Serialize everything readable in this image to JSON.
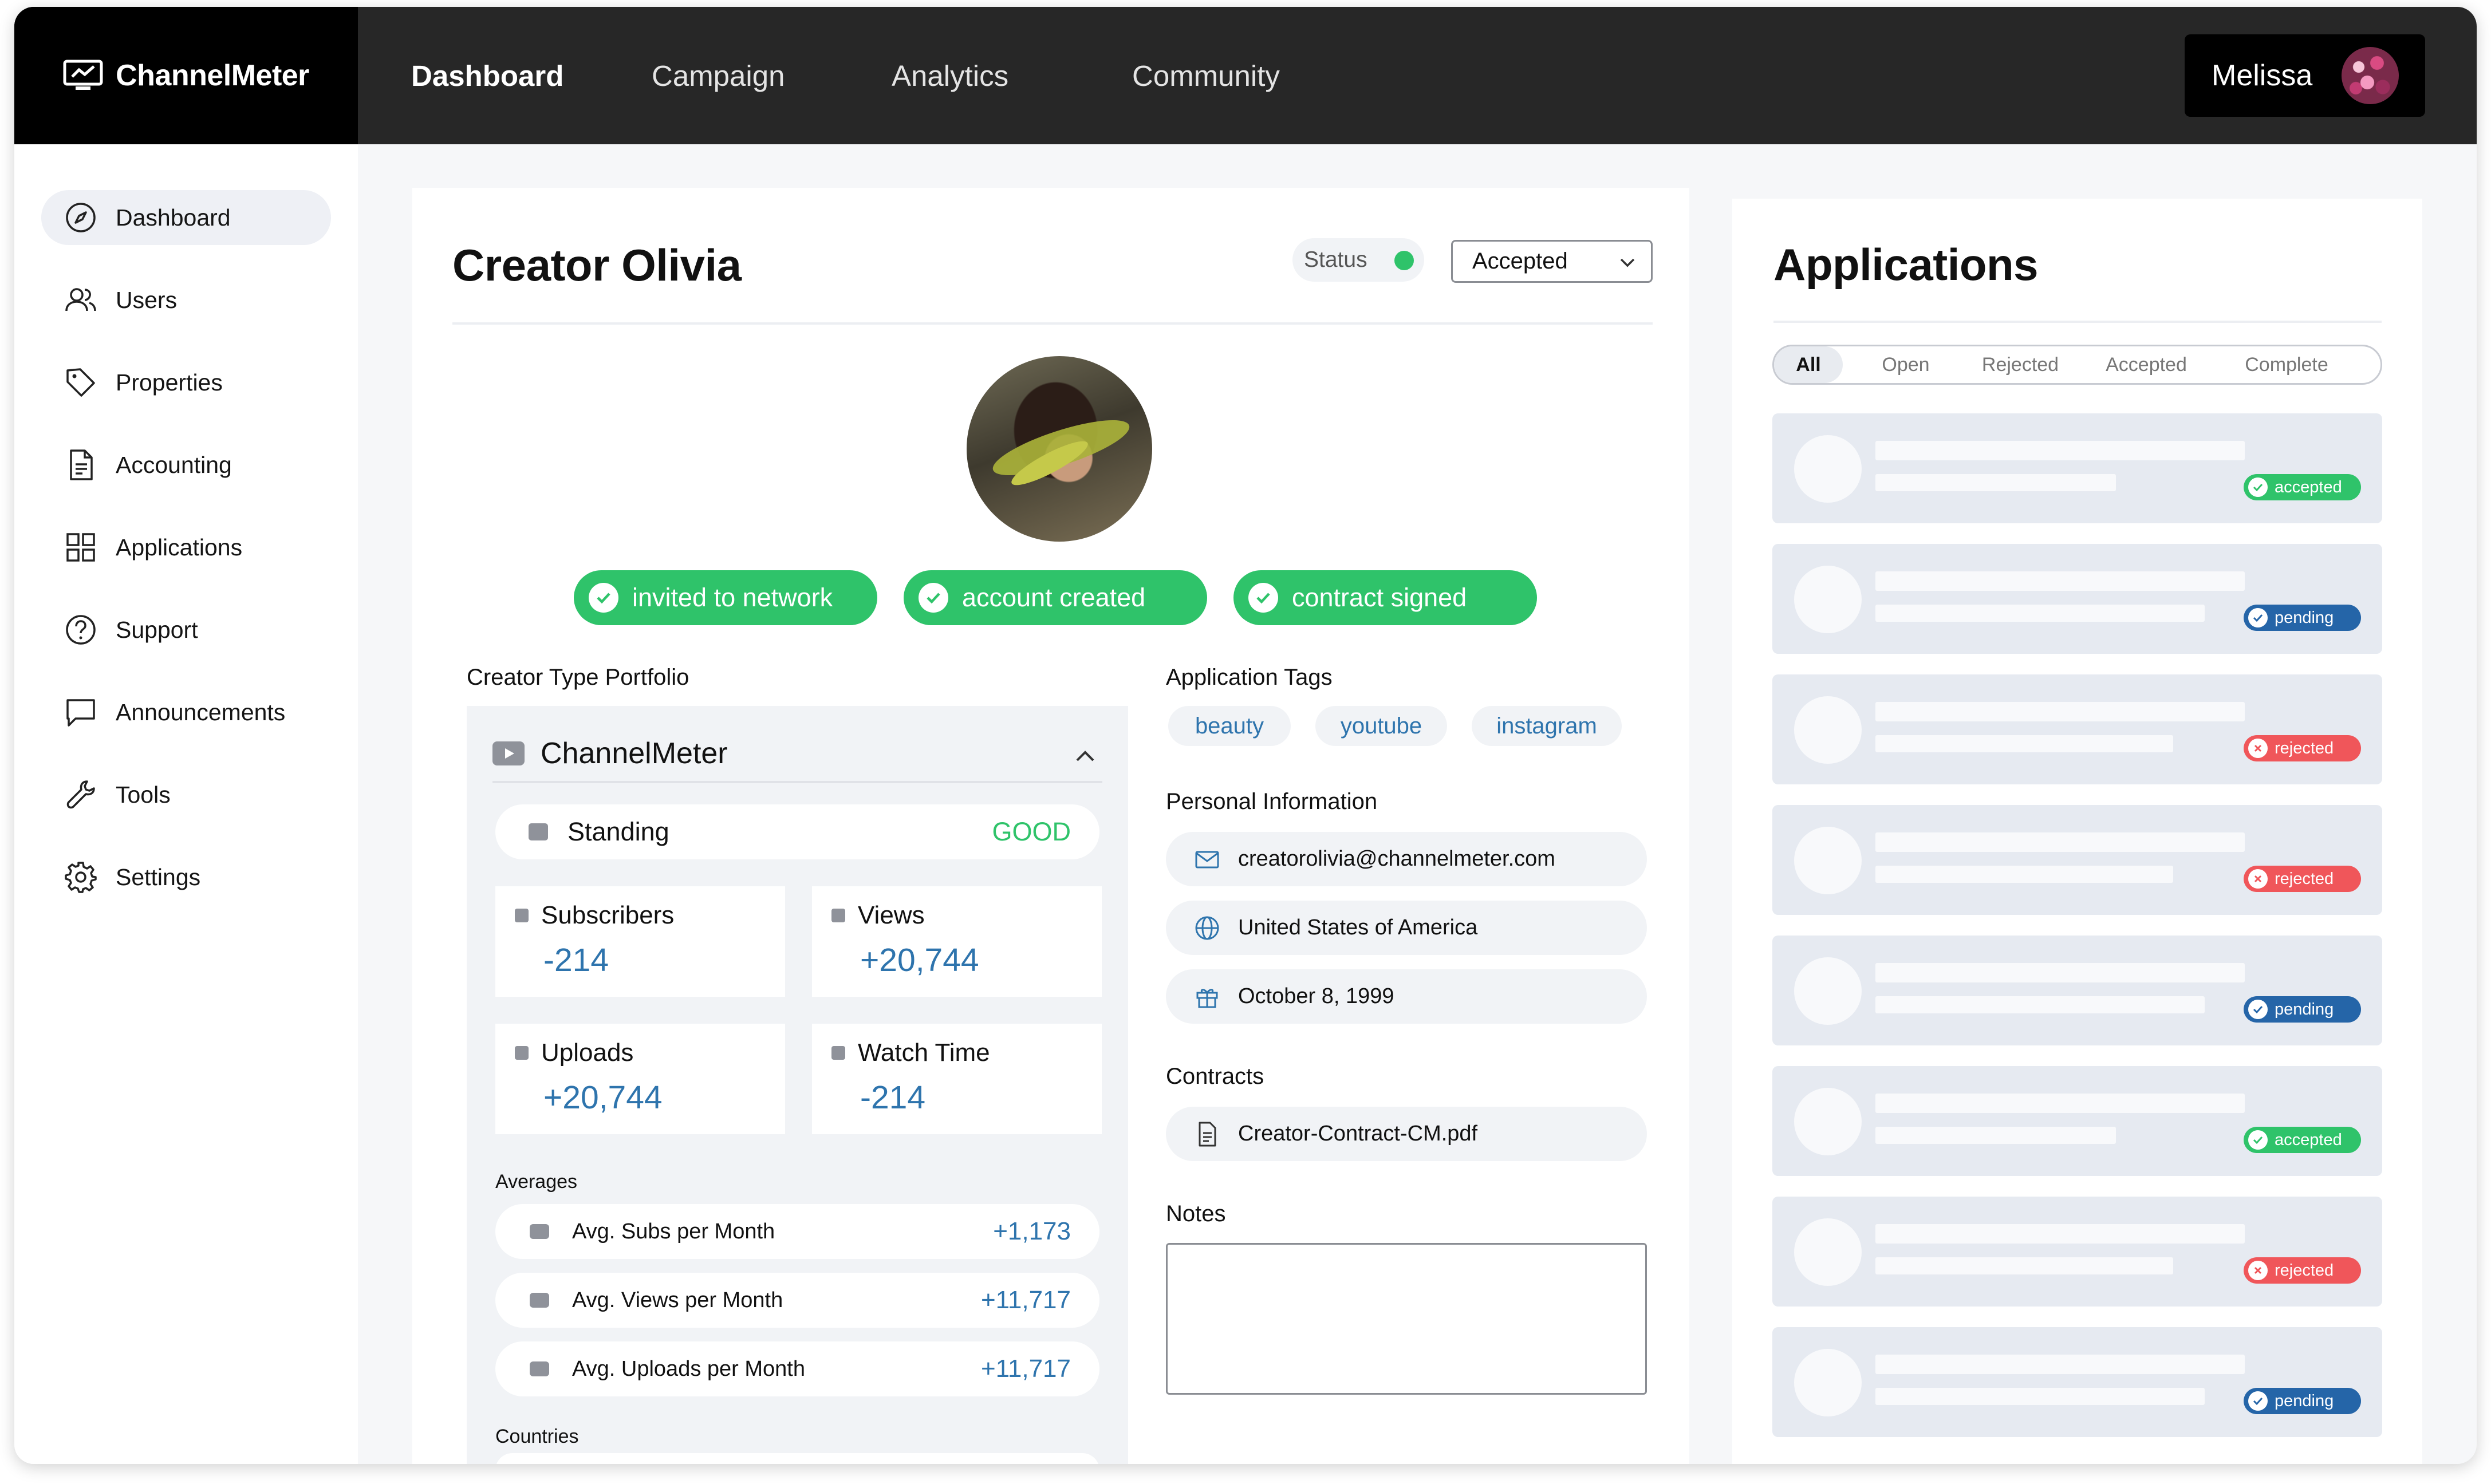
{
  "brand": "ChannelMeter",
  "topnav": [
    "Dashboard",
    "Campaign",
    "Analytics",
    "Community"
  ],
  "user": {
    "name": "Melissa"
  },
  "sidebar": {
    "items": [
      {
        "label": "Dashboard",
        "icon": "compass-icon"
      },
      {
        "label": "Users",
        "icon": "users-icon"
      },
      {
        "label": "Properties",
        "icon": "tag-icon"
      },
      {
        "label": "Accounting",
        "icon": "document-icon"
      },
      {
        "label": "Applications",
        "icon": "grid-icon"
      },
      {
        "label": "Support",
        "icon": "help-icon"
      },
      {
        "label": "Announcements",
        "icon": "chat-icon"
      },
      {
        "label": "Tools",
        "icon": "wrench-icon"
      },
      {
        "label": "Settings",
        "icon": "gear-icon"
      }
    ]
  },
  "creator": {
    "title": "Creator Olivia",
    "status_label": "Status",
    "status_value": "Accepted",
    "badges": [
      "invited to network",
      "account created",
      "contract signed"
    ]
  },
  "portfolio": {
    "section_label": "Creator Type Portfolio",
    "platform": "ChannelMeter",
    "standing_label": "Standing",
    "standing_value": "GOOD",
    "stats": [
      {
        "label": "Subscribers",
        "value": "-214"
      },
      {
        "label": "Views",
        "value": "+20,744"
      },
      {
        "label": "Uploads",
        "value": "+20,744"
      },
      {
        "label": "Watch Time",
        "value": "-214"
      }
    ],
    "averages_label": "Averages",
    "averages": [
      {
        "label": "Avg. Subs per Month",
        "value": "+1,173"
      },
      {
        "label": "Avg. Views per Month",
        "value": "+11,717"
      },
      {
        "label": "Avg. Uploads per Month",
        "value": "+11,717"
      }
    ],
    "countries_label": "Countries"
  },
  "tags": {
    "label": "Application Tags",
    "items": [
      "beauty",
      "youtube",
      "instagram"
    ]
  },
  "personal": {
    "label": "Personal Information",
    "email": "creatorolivia@channelmeter.com",
    "country": "United States of America",
    "birthday": "October 8, 1999"
  },
  "contracts": {
    "label": "Contracts",
    "file": "Creator-Contract-CM.pdf"
  },
  "notes": {
    "label": "Notes",
    "value": ""
  },
  "applications": {
    "title": "Applications",
    "tabs": [
      "All",
      "Open",
      "Rejected",
      "Accepted",
      "Complete"
    ],
    "active_tab": "All",
    "cards": [
      {
        "status": "accepted"
      },
      {
        "status": "pending"
      },
      {
        "status": "rejected"
      },
      {
        "status": "rejected"
      },
      {
        "status": "pending"
      },
      {
        "status": "accepted"
      },
      {
        "status": "rejected"
      },
      {
        "status": "pending"
      }
    ]
  },
  "colors": {
    "accent_green": "#2fc36a",
    "accent_blue": "#2e74ad",
    "pending_blue": "#2565a8",
    "rejected_red": "#f0565a",
    "header_bg": "#272727"
  }
}
